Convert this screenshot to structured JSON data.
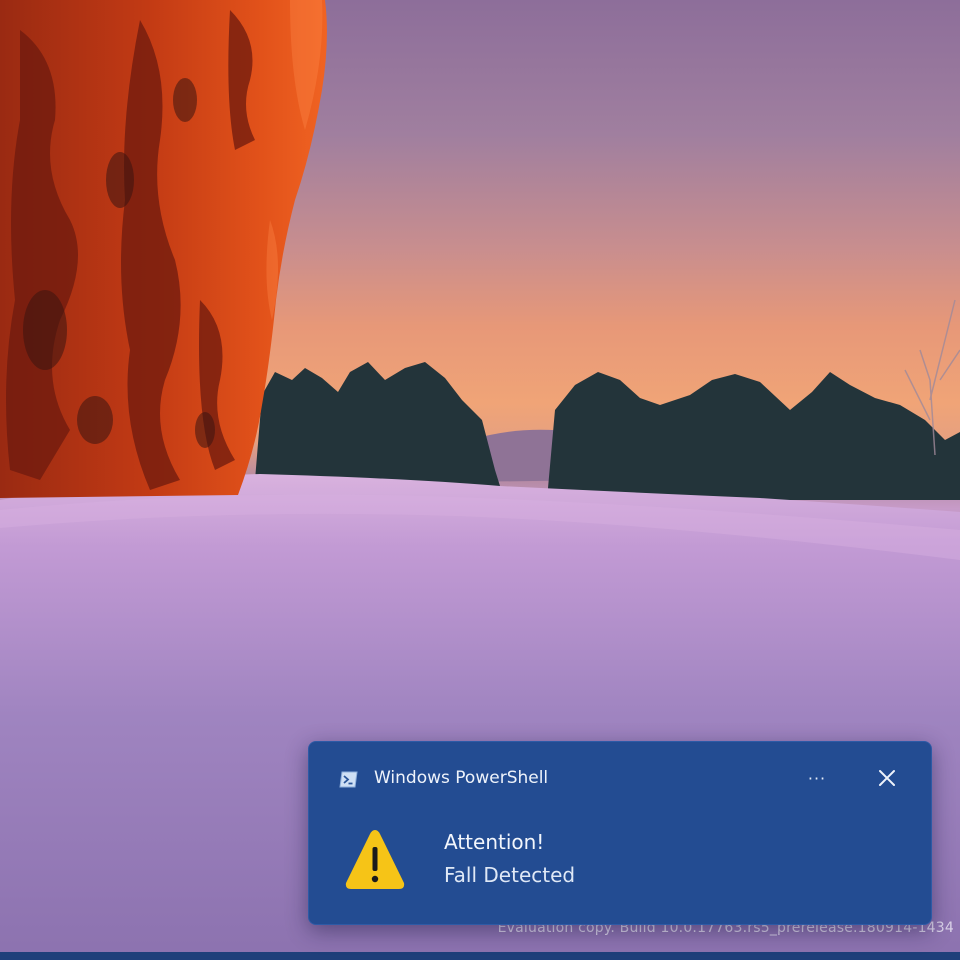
{
  "toast": {
    "app_name": "Windows PowerShell",
    "app_icon": "powershell-icon",
    "more_label": "···",
    "close_icon": "close-icon",
    "warning_icon": "warning-icon",
    "title": "Attention!",
    "body": "Fall Detected",
    "background_color": "#234c92"
  },
  "desktop": {
    "watermark": "Evaluation copy. Build 10.0.17763.rs5_prerelease.180914-1434"
  }
}
